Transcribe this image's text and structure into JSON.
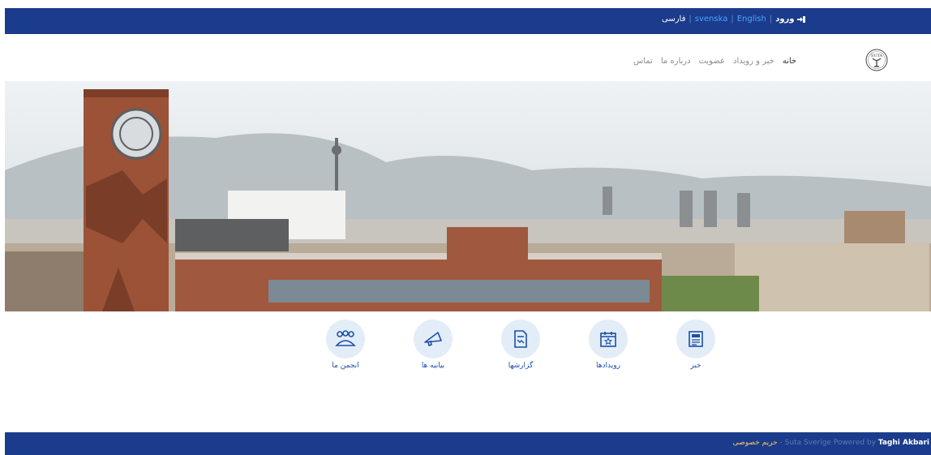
{
  "topbar": {
    "login_label": "ورود",
    "languages": [
      "English",
      "svenska"
    ],
    "current_language": "فارسی"
  },
  "nav": {
    "home": "خانه",
    "news_events": "خبر و رویداد",
    "membership": "عضویت",
    "about": "درباره ما",
    "contact": "تماس"
  },
  "logo": {
    "text": "SUTA"
  },
  "features": [
    {
      "label": "خبر",
      "icon": "newspaper-icon"
    },
    {
      "label": "رویدادها",
      "icon": "calendar-star-icon"
    },
    {
      "label": "گزارشها",
      "icon": "report-icon"
    },
    {
      "label": "بیانیه ها",
      "icon": "megaphone-icon"
    },
    {
      "label": "انجمن ما",
      "icon": "group-icon"
    }
  ],
  "footer": {
    "privacy": "حریم خصوصی",
    "site": "- Suta Sverige Powered by",
    "author": "Taghi Akbari"
  },
  "colors": {
    "brand_blue": "#1b3c8c",
    "link_blue": "#4aa3ff",
    "icon_bg": "#e3edf8",
    "icon_blue": "#1b4fa8"
  }
}
